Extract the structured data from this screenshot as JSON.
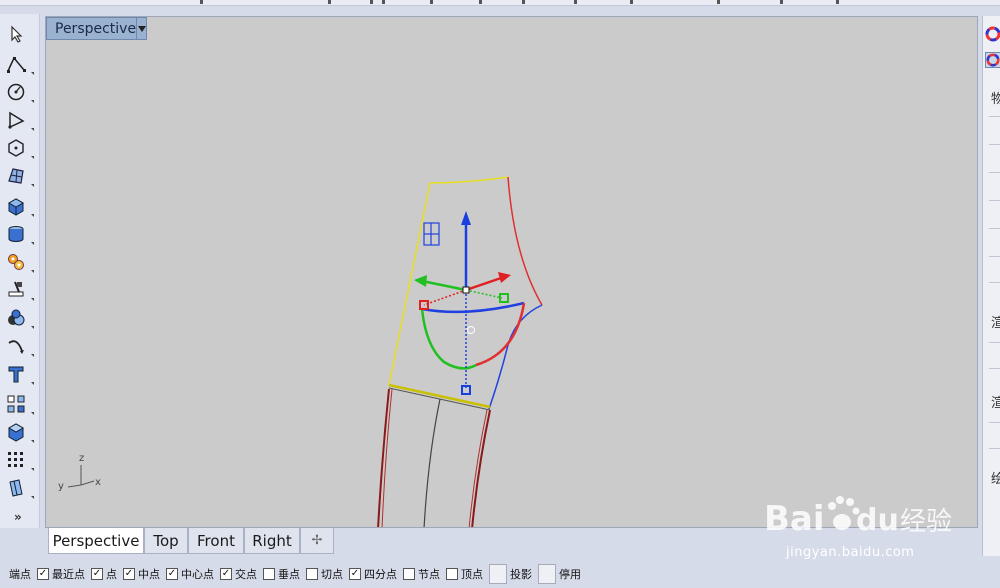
{
  "viewport": {
    "title": "Perspective",
    "axes": {
      "x": "x",
      "y": "y",
      "z": "z"
    }
  },
  "viewport_tabs": [
    {
      "label": "Perspective",
      "active": true
    },
    {
      "label": "Top",
      "active": false
    },
    {
      "label": "Front",
      "active": false
    },
    {
      "label": "Right",
      "active": false
    },
    {
      "label": "✢",
      "active": false
    }
  ],
  "left_toolbar": {
    "tools": [
      "select-arrow-icon",
      "polyline-icon",
      "circle-icon",
      "arc-icon",
      "polygon-icon",
      "surface-icon",
      "box-solid-icon",
      "cylinder-icon",
      "transform-gears-icon",
      "trim-icon",
      "boolean-icon",
      "curve-icon",
      "text-icon",
      "group-icon",
      "solid-box-icon",
      "array-grid-icon",
      "render-icon"
    ],
    "more": "»"
  },
  "right_panel": {
    "labels": [
      "物",
      "渲",
      "渲",
      "绘"
    ]
  },
  "osnap": {
    "items": [
      {
        "label": "端点",
        "checked": true
      },
      {
        "label": "最近点",
        "checked": true
      },
      {
        "label": "点",
        "checked": true
      },
      {
        "label": "中点",
        "checked": true
      },
      {
        "label": "中心点",
        "checked": true
      },
      {
        "label": "交点",
        "checked": true
      },
      {
        "label": "垂点",
        "checked": false
      },
      {
        "label": "切点",
        "checked": false
      },
      {
        "label": "四分点",
        "checked": true
      },
      {
        "label": "节点",
        "checked": false
      },
      {
        "label": "顶点",
        "checked": false
      }
    ],
    "buttons": [
      "投影",
      "停用"
    ]
  },
  "watermark": {
    "brand": "Bai",
    "brand_suffix": "du",
    "cn": "经验",
    "url": "jingyan.baidu.com"
  },
  "colors": {
    "viewport_bg": "#cbcbcb",
    "title_bg": "#9ab2cf",
    "gumball_x": "#e02020",
    "gumball_y": "#20c020",
    "gumball_z": "#1a3fe0",
    "edge_yellow": "#e8e020",
    "edge_red": "#e03030",
    "edge_blue": "#2040e0"
  }
}
